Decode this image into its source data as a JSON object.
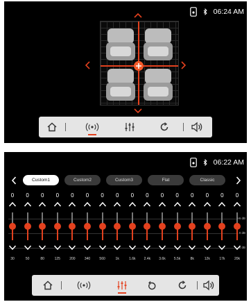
{
  "screen1": {
    "status": {
      "time": "06:24 AM",
      "bluetooth_icon": "bluetooth-icon",
      "phone_icon": "phone-icon"
    },
    "navbar": {
      "items": [
        "home-icon",
        "surround-icon",
        "equalizer-icon",
        "loop-icon",
        "volume-icon"
      ],
      "active": "surround-icon"
    }
  },
  "screen2": {
    "status": {
      "time": "06:22 AM"
    },
    "presets": {
      "items": [
        "Custom1",
        "Custom2",
        "Custom3",
        "Flat",
        "Classic"
      ],
      "selected": "Custom1"
    },
    "eq": {
      "gains": [
        "0",
        "0",
        "0",
        "0",
        "0",
        "0",
        "0",
        "0",
        "0",
        "0",
        "0",
        "0",
        "0",
        "0",
        "0",
        "0"
      ],
      "gain_values": [
        0,
        0,
        0,
        0,
        0,
        0,
        0,
        0,
        0,
        0,
        0,
        0,
        0,
        0,
        0,
        0
      ],
      "frequencies": [
        "30",
        "50",
        "80",
        "125",
        "200",
        "340",
        "560",
        "1k",
        "1.6k",
        "2.4k",
        "3.6k",
        "5.5k",
        "8k",
        "12k",
        "17k",
        "20k"
      ],
      "db_labels": [
        "+6 dB",
        "0 dB",
        "-6 dB"
      ]
    },
    "navbar": {
      "items": [
        "home-icon",
        "surround-icon",
        "equalizer-icon",
        "reset-icon",
        "loop-icon",
        "volume-icon"
      ],
      "active": "equalizer-icon"
    }
  },
  "colors": {
    "accent": "#e3411e",
    "background": "#000000",
    "navbar": "#e5e5e5"
  }
}
